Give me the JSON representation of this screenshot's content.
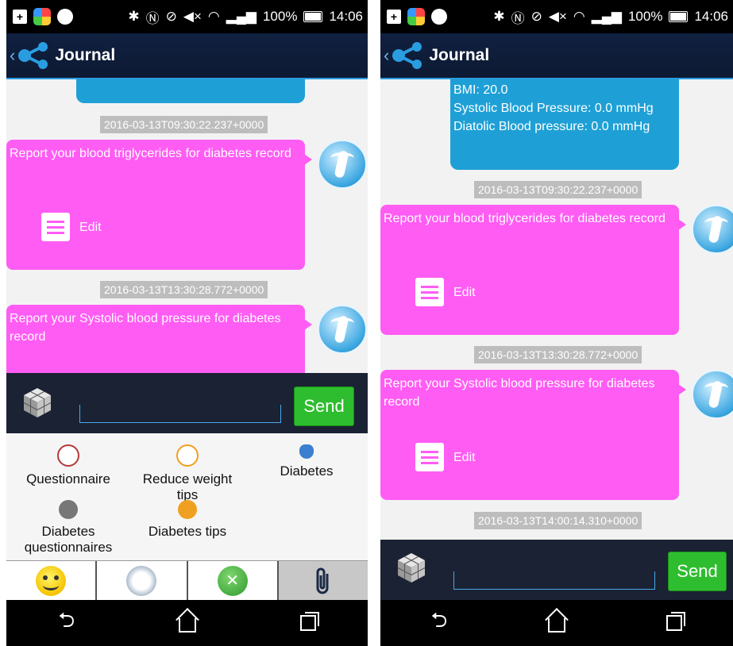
{
  "status_bar": {
    "battery": "100%",
    "time": "14:06"
  },
  "app": {
    "title": "Journal"
  },
  "left": {
    "timestamps": [
      "2016-03-13T09:30:22.237+0000",
      "2016-03-13T13:30:28.772+0000"
    ],
    "messages": [
      {
        "text": "Report your blood triglycerides for diabetes record",
        "edit_label": "Edit"
      },
      {
        "text": "Report your Systolic blood pressure for diabetes record"
      }
    ],
    "send_label": "Send",
    "menu_items": [
      {
        "label": "Questionnaire",
        "icon": "questionnaire-icon",
        "color": "#b23a3a"
      },
      {
        "label": "Reduce weight tips",
        "icon": "search-tips-icon",
        "color": "#f0a020"
      },
      {
        "label": "Diabetes",
        "icon": "diabetes-icon",
        "color": "#3a7fd0"
      },
      {
        "label": "Diabetes questionnaires",
        "icon": "questionnaire-gray-icon",
        "color": "#777777"
      },
      {
        "label": "Diabetes tips",
        "icon": "tips-icon",
        "color": "#f0a020"
      }
    ],
    "tabs": [
      {
        "icon": "smiley-icon"
      },
      {
        "icon": "compass-icon"
      },
      {
        "icon": "network-icon"
      },
      {
        "icon": "paperclip-icon",
        "active": true
      }
    ]
  },
  "right": {
    "info_lines": [
      "BMI: 20.0",
      "Systolic Blood Pressure: 0.0 mmHg",
      "Diatolic Blood pressure: 0.0 mmHg"
    ],
    "timestamps": [
      "2016-03-13T09:30:22.237+0000",
      "2016-03-13T13:30:28.772+0000",
      "2016-03-13T14:00:14.310+0000"
    ],
    "messages": [
      {
        "text": "Report your blood triglycerides for diabetes record",
        "edit_label": "Edit"
      },
      {
        "text": "Report your Systolic blood pressure for diabetes record",
        "edit_label": "Edit"
      }
    ],
    "send_label": "Send"
  },
  "colors": {
    "bubble": "#ff5cf4",
    "info_bubble": "#1ea0d6",
    "send": "#2ebd2e",
    "header": "#102040"
  }
}
